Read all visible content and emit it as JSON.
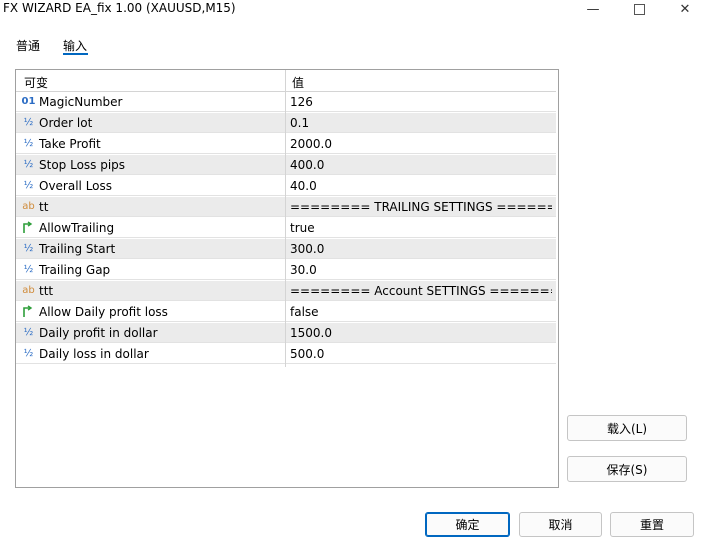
{
  "window": {
    "title": "FX WIZARD EA_fix 1.00 (XAUUSD,M15)",
    "minimize_glyph": "—",
    "close_glyph": "✕"
  },
  "tabs": [
    {
      "label": "普通"
    },
    {
      "label": "输入",
      "selected": true
    }
  ],
  "grid": {
    "header_name": "可变",
    "header_value": "值",
    "rows": [
      {
        "type": "int",
        "icon_text": "01",
        "name": "MagicNumber",
        "value": "126"
      },
      {
        "type": "double",
        "icon_text": "½",
        "name": "Order lot",
        "value": "0.1"
      },
      {
        "type": "double",
        "icon_text": "½",
        "name": "Take Profit",
        "value": "2000.0"
      },
      {
        "type": "double",
        "icon_text": "½",
        "name": "Stop Loss pips",
        "value": "400.0"
      },
      {
        "type": "double",
        "icon_text": "½",
        "name": "Overall Loss",
        "value": "40.0"
      },
      {
        "type": "string",
        "icon_text": "ab",
        "name": "tt",
        "value": "======== TRAILING SETTINGS ======..."
      },
      {
        "type": "bool",
        "icon_text": "",
        "name": "AllowTrailing",
        "value": "true"
      },
      {
        "type": "double",
        "icon_text": "½",
        "name": "Trailing Start",
        "value": "300.0"
      },
      {
        "type": "double",
        "icon_text": "½",
        "name": "Trailing Gap",
        "value": "30.0"
      },
      {
        "type": "string",
        "icon_text": "ab",
        "name": "ttt",
        "value": "======== Account SETTINGS =======..."
      },
      {
        "type": "bool",
        "icon_text": "",
        "name": "Allow Daily profit loss",
        "value": "false"
      },
      {
        "type": "double",
        "icon_text": "½",
        "name": "Daily profit in dollar",
        "value": "1500.0"
      },
      {
        "type": "double",
        "icon_text": "½",
        "name": "Daily loss in dollar",
        "value": "500.0"
      }
    ]
  },
  "buttons": {
    "load": "载入(L)",
    "save": "保存(S)",
    "ok": "确定",
    "cancel": "取消",
    "reset": "重置"
  },
  "colors": {
    "accent": "#0067c0",
    "int_icon": "#2b6cc4",
    "string_icon": "#d08b3a",
    "bool_icon": "#2e9e3a"
  }
}
